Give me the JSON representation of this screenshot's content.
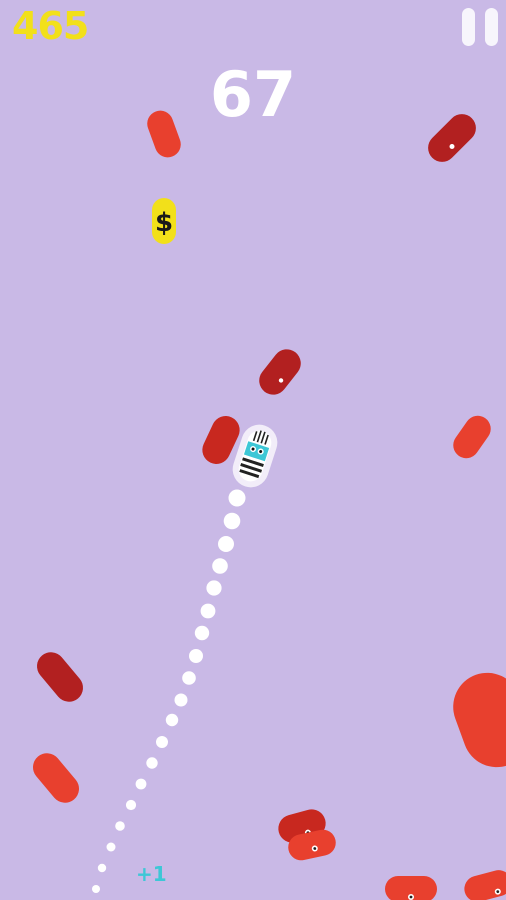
{
  "hud": {
    "coins": "465",
    "score": "67",
    "pause_icon": "pause-icon",
    "bonus_text": "+1"
  },
  "coin_pickup": {
    "symbol": "$",
    "color": "#f2e01a"
  },
  "colors": {
    "background": "#c9b9e6",
    "enemy_light": "#e8402e",
    "enemy_dark": "#b22020",
    "trail": "#ffffff",
    "player_accent": "#3dc7d6",
    "coin_text": "#f2e01a"
  }
}
